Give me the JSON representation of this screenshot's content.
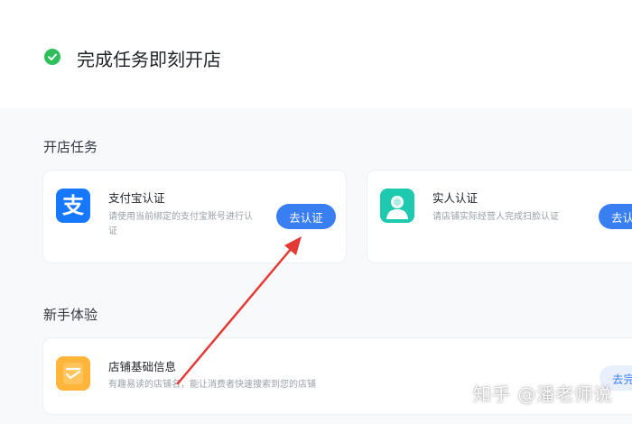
{
  "header": {
    "title": "完成任务即刻开店"
  },
  "sections": {
    "shop_tasks_title": "开店任务",
    "newbie_title": "新手体验"
  },
  "cards": {
    "alipay": {
      "icon_name": "alipay-icon",
      "icon_glyph": "支",
      "title": "支付宝认证",
      "desc_line1": "请使用当前绑定的支付宝账号进行认",
      "desc_line2": "证",
      "button": "去认证"
    },
    "realname": {
      "icon_name": "person-icon",
      "title": "实人认证",
      "desc": "请店铺实际经营人完成扫脸认证",
      "button": "去认"
    },
    "store_info": {
      "icon_name": "store-info-icon",
      "title": "店铺基础信息",
      "desc": "有趣易读的店铺名，能让消费者快速搜索到您的店铺",
      "button": "去完"
    }
  },
  "watermark": "知乎 @潘老师说",
  "colors": {
    "accent": "#3a7ff2",
    "success": "#2fbf5a",
    "alipay_blue": "#1678ff",
    "annotation_red": "#e53935"
  }
}
